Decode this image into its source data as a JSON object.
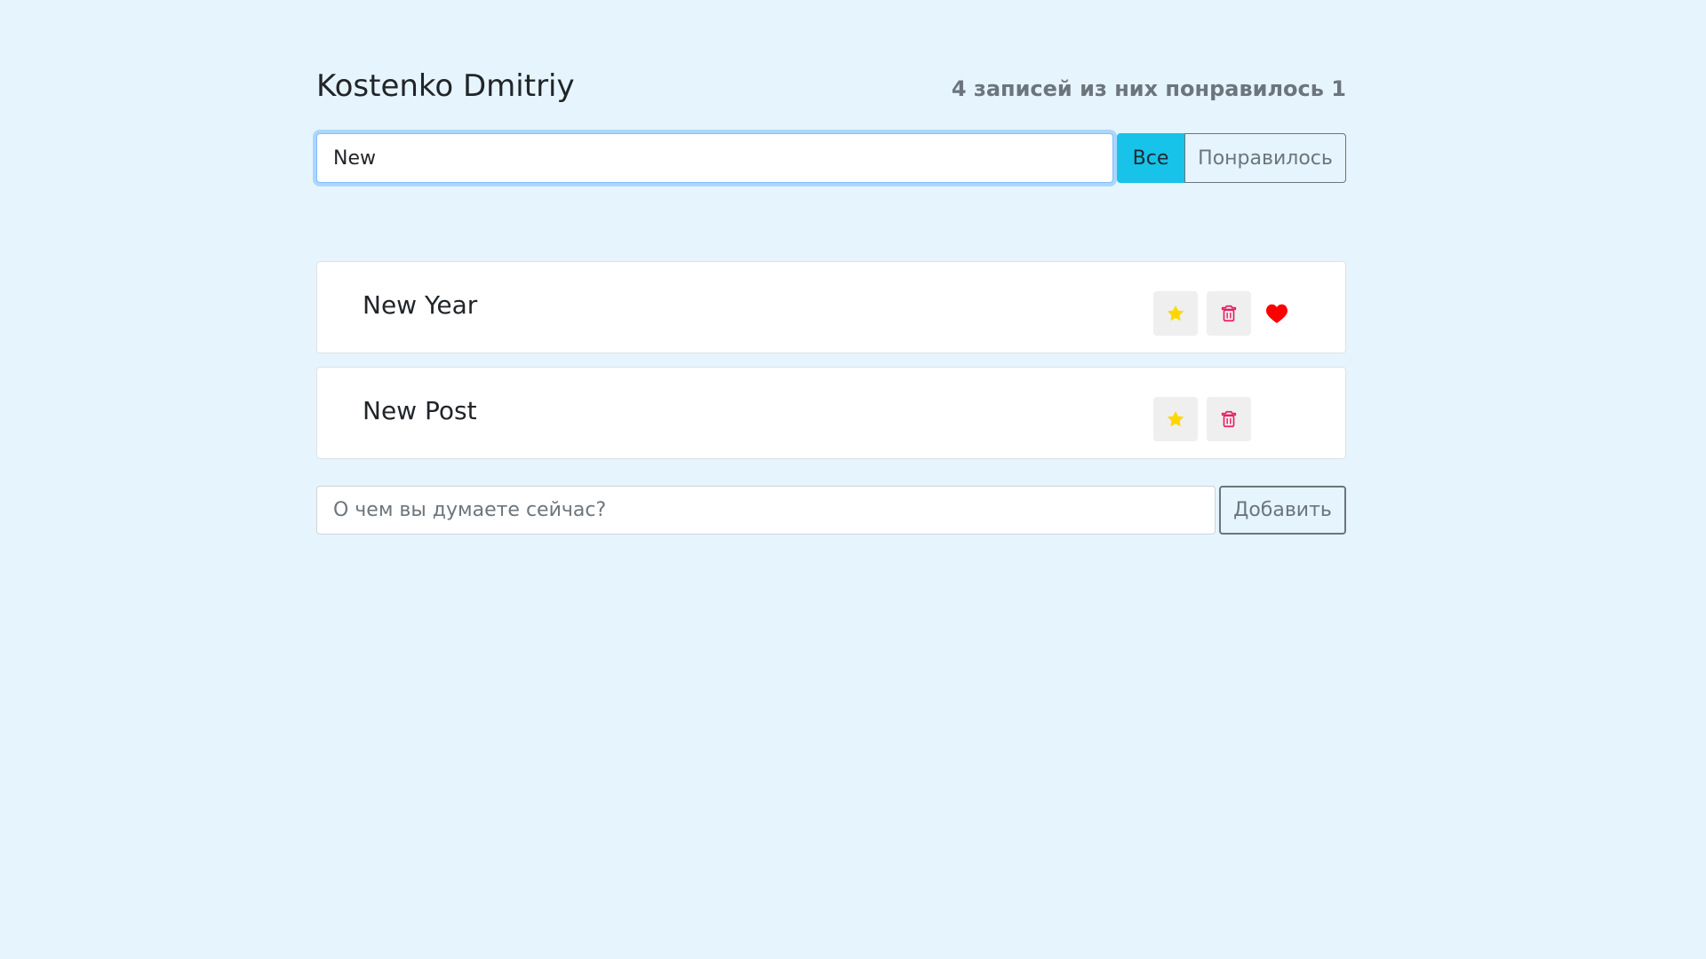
{
  "header": {
    "title": "Kostenko Dmitriy",
    "counter": "4 записей из них понравилось 1"
  },
  "search": {
    "value": "New",
    "filters": [
      {
        "label": "Все",
        "active": true
      },
      {
        "label": "Понравилось",
        "active": false
      }
    ]
  },
  "posts": [
    {
      "label": "New Year",
      "important": true,
      "liked": true
    },
    {
      "label": "New Post",
      "important": true,
      "liked": false
    }
  ],
  "add_form": {
    "placeholder": "О чем вы думаете сейчас?",
    "button_label": "Добавить"
  },
  "colors": {
    "background": "#e6f4fd",
    "star": "#ffd700",
    "trash": "#e91e63",
    "heart": "#ff0000",
    "active_filter": "#17c3e8"
  },
  "icons": {
    "star": "star-icon",
    "trash": "trash-icon",
    "heart": "heart-icon"
  }
}
